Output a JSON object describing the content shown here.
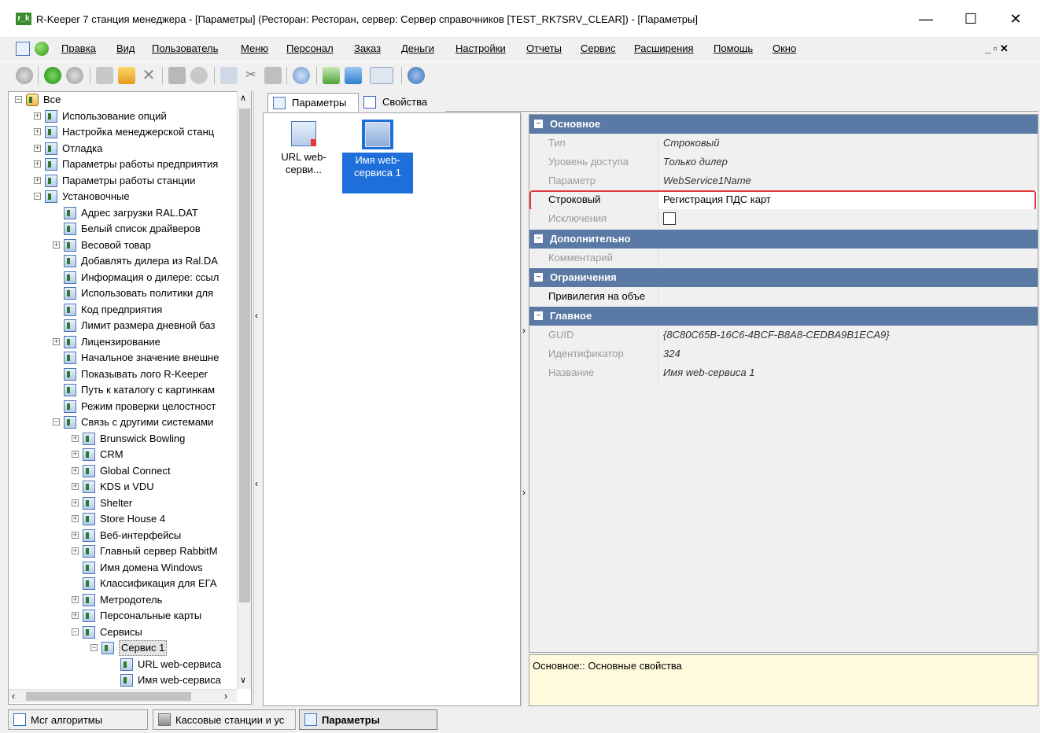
{
  "window": {
    "logo": "r_k",
    "title": "R-Keeper 7 станция менеджера - [Параметры] (Ресторан: Ресторан, сервер: Сервер справочников [TEST_RK7SRV_CLEAR]) - [Параметры]",
    "minimize": "—",
    "maximize": "☐",
    "close": "✕",
    "mdi_controls": "_ ▫ ✕"
  },
  "menu": [
    {
      "label": "Правка",
      "name": "menu-edit"
    },
    {
      "label": "Вид",
      "name": "menu-view"
    },
    {
      "label": "Пользователь",
      "name": "menu-user"
    },
    {
      "label": "Меню",
      "name": "menu-menu"
    },
    {
      "label": "Персонал",
      "name": "menu-staff"
    },
    {
      "label": "Заказ",
      "name": "menu-order"
    },
    {
      "label": "Деньги",
      "name": "menu-money"
    },
    {
      "label": "Настройки",
      "name": "menu-settings"
    },
    {
      "label": "Отчеты",
      "name": "menu-reports"
    },
    {
      "label": "Сервис",
      "name": "menu-service"
    },
    {
      "label": "Расширения",
      "name": "menu-extensions"
    },
    {
      "label": "Помощь",
      "name": "menu-help"
    },
    {
      "label": "Окно",
      "name": "menu-window"
    }
  ],
  "tree": [
    {
      "label": "Все",
      "level": 0,
      "exp": "−",
      "icon": "home-icon"
    },
    {
      "label": "Использование опций",
      "level": 1,
      "exp": "+"
    },
    {
      "label": "Настройка менеджерской станц",
      "level": 1,
      "exp": "+"
    },
    {
      "label": "Отладка",
      "level": 1,
      "exp": "+"
    },
    {
      "label": "Параметры работы предприятия",
      "level": 1,
      "exp": "+"
    },
    {
      "label": "Параметры работы станции",
      "level": 1,
      "exp": "+"
    },
    {
      "label": "Установочные",
      "level": 1,
      "exp": "−"
    },
    {
      "label": "Адрес загрузки RAL.DAT",
      "level": 2,
      "exp": ""
    },
    {
      "label": "Белый список драйверов",
      "level": 2,
      "exp": ""
    },
    {
      "label": "Весовой товар",
      "level": 2,
      "exp": "+"
    },
    {
      "label": "Добавлять дилера из Ral.DA",
      "level": 2,
      "exp": ""
    },
    {
      "label": "Информация о дилере: ссыл",
      "level": 2,
      "exp": ""
    },
    {
      "label": "Использовать политики для",
      "level": 2,
      "exp": ""
    },
    {
      "label": "Код предприятия",
      "level": 2,
      "exp": ""
    },
    {
      "label": "Лимит размера дневной баз",
      "level": 2,
      "exp": ""
    },
    {
      "label": "Лицензирование",
      "level": 2,
      "exp": "+"
    },
    {
      "label": "Начальное значение внешне",
      "level": 2,
      "exp": ""
    },
    {
      "label": "Показывать лого R-Keeper",
      "level": 2,
      "exp": ""
    },
    {
      "label": "Путь к каталогу с картинкам",
      "level": 2,
      "exp": ""
    },
    {
      "label": "Режим проверки целостност",
      "level": 2,
      "exp": ""
    },
    {
      "label": "Связь с другими системами",
      "level": 2,
      "exp": "−"
    },
    {
      "label": "Brunswick Bowling",
      "level": 3,
      "exp": "+"
    },
    {
      "label": "CRM",
      "level": 3,
      "exp": "+"
    },
    {
      "label": "Global Connect",
      "level": 3,
      "exp": "+"
    },
    {
      "label": "KDS и VDU",
      "level": 3,
      "exp": "+"
    },
    {
      "label": "Shelter",
      "level": 3,
      "exp": "+"
    },
    {
      "label": "Store House 4",
      "level": 3,
      "exp": "+"
    },
    {
      "label": "Веб-интерфейсы",
      "level": 3,
      "exp": "+"
    },
    {
      "label": "Главный сервер RabbitM",
      "level": 3,
      "exp": "+"
    },
    {
      "label": "Имя домена Windows",
      "level": 3,
      "exp": ""
    },
    {
      "label": "Классификация для ЕГА",
      "level": 3,
      "exp": ""
    },
    {
      "label": "Метродотель",
      "level": 3,
      "exp": "+"
    },
    {
      "label": "Персональные карты",
      "level": 3,
      "exp": "+"
    },
    {
      "label": "Сервисы",
      "level": 3,
      "exp": "−"
    },
    {
      "label": "Сервис 1",
      "level": 4,
      "exp": "−"
    },
    {
      "label": "URL web-сервиса",
      "level": 5,
      "exp": ""
    },
    {
      "label": "Имя web-сервиса",
      "level": 5,
      "exp": ""
    }
  ],
  "tabs": [
    {
      "label": "Параметры"
    },
    {
      "label": "Свойства"
    }
  ],
  "items": [
    {
      "label": "URL web-серви..."
    },
    {
      "label": "Имя web-сервиса 1"
    }
  ],
  "property_grid": {
    "sections": [
      {
        "title": "Основное",
        "rows": [
          {
            "name": "Тип",
            "value": "Строковый"
          },
          {
            "name": "Уровень доступа",
            "value": "Только дилер"
          },
          {
            "name": "Параметр",
            "value": "WebService1Name"
          },
          {
            "name": "Строковый",
            "value": "Регистрация ПДС карт"
          },
          {
            "name": "Исключения",
            "value": ""
          }
        ]
      },
      {
        "title": "Дополнительно",
        "rows": [
          {
            "name": "Комментарий",
            "value": ""
          }
        ]
      },
      {
        "title": "Ограничения",
        "rows": [
          {
            "name": "Привилегия на объе",
            "value": ""
          }
        ]
      },
      {
        "title": "Главное",
        "rows": [
          {
            "name": "GUID",
            "value": "{8C80C65B-16C6-4BCF-B8A8-CEDBA9B1ECA9}"
          },
          {
            "name": "Идентификатор",
            "value": "324"
          },
          {
            "name": "Название",
            "value": "Имя web-сервиса 1"
          }
        ]
      }
    ],
    "highlight_color": "#e0393e",
    "description": "Основное:: Основные свойства"
  },
  "taskbar": [
    {
      "label": "Мсг алгоритмы"
    },
    {
      "label": "Кассовые станции и ус"
    },
    {
      "label": "Параметры"
    }
  ]
}
